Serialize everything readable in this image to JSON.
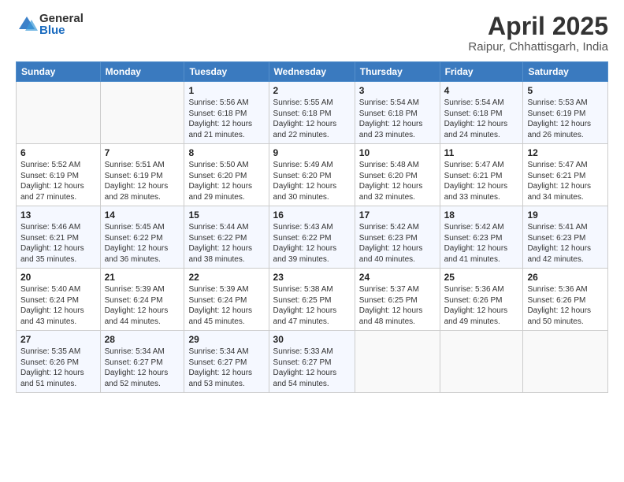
{
  "header": {
    "logo_general": "General",
    "logo_blue": "Blue",
    "title": "April 2025",
    "location": "Raipur, Chhattisgarh, India"
  },
  "days_of_week": [
    "Sunday",
    "Monday",
    "Tuesday",
    "Wednesday",
    "Thursday",
    "Friday",
    "Saturday"
  ],
  "weeks": [
    [
      {
        "day": "",
        "info": ""
      },
      {
        "day": "",
        "info": ""
      },
      {
        "day": "1",
        "info": "Sunrise: 5:56 AM\nSunset: 6:18 PM\nDaylight: 12 hours and 21 minutes."
      },
      {
        "day": "2",
        "info": "Sunrise: 5:55 AM\nSunset: 6:18 PM\nDaylight: 12 hours and 22 minutes."
      },
      {
        "day": "3",
        "info": "Sunrise: 5:54 AM\nSunset: 6:18 PM\nDaylight: 12 hours and 23 minutes."
      },
      {
        "day": "4",
        "info": "Sunrise: 5:54 AM\nSunset: 6:18 PM\nDaylight: 12 hours and 24 minutes."
      },
      {
        "day": "5",
        "info": "Sunrise: 5:53 AM\nSunset: 6:19 PM\nDaylight: 12 hours and 26 minutes."
      }
    ],
    [
      {
        "day": "6",
        "info": "Sunrise: 5:52 AM\nSunset: 6:19 PM\nDaylight: 12 hours and 27 minutes."
      },
      {
        "day": "7",
        "info": "Sunrise: 5:51 AM\nSunset: 6:19 PM\nDaylight: 12 hours and 28 minutes."
      },
      {
        "day": "8",
        "info": "Sunrise: 5:50 AM\nSunset: 6:20 PM\nDaylight: 12 hours and 29 minutes."
      },
      {
        "day": "9",
        "info": "Sunrise: 5:49 AM\nSunset: 6:20 PM\nDaylight: 12 hours and 30 minutes."
      },
      {
        "day": "10",
        "info": "Sunrise: 5:48 AM\nSunset: 6:20 PM\nDaylight: 12 hours and 32 minutes."
      },
      {
        "day": "11",
        "info": "Sunrise: 5:47 AM\nSunset: 6:21 PM\nDaylight: 12 hours and 33 minutes."
      },
      {
        "day": "12",
        "info": "Sunrise: 5:47 AM\nSunset: 6:21 PM\nDaylight: 12 hours and 34 minutes."
      }
    ],
    [
      {
        "day": "13",
        "info": "Sunrise: 5:46 AM\nSunset: 6:21 PM\nDaylight: 12 hours and 35 minutes."
      },
      {
        "day": "14",
        "info": "Sunrise: 5:45 AM\nSunset: 6:22 PM\nDaylight: 12 hours and 36 minutes."
      },
      {
        "day": "15",
        "info": "Sunrise: 5:44 AM\nSunset: 6:22 PM\nDaylight: 12 hours and 38 minutes."
      },
      {
        "day": "16",
        "info": "Sunrise: 5:43 AM\nSunset: 6:22 PM\nDaylight: 12 hours and 39 minutes."
      },
      {
        "day": "17",
        "info": "Sunrise: 5:42 AM\nSunset: 6:23 PM\nDaylight: 12 hours and 40 minutes."
      },
      {
        "day": "18",
        "info": "Sunrise: 5:42 AM\nSunset: 6:23 PM\nDaylight: 12 hours and 41 minutes."
      },
      {
        "day": "19",
        "info": "Sunrise: 5:41 AM\nSunset: 6:23 PM\nDaylight: 12 hours and 42 minutes."
      }
    ],
    [
      {
        "day": "20",
        "info": "Sunrise: 5:40 AM\nSunset: 6:24 PM\nDaylight: 12 hours and 43 minutes."
      },
      {
        "day": "21",
        "info": "Sunrise: 5:39 AM\nSunset: 6:24 PM\nDaylight: 12 hours and 44 minutes."
      },
      {
        "day": "22",
        "info": "Sunrise: 5:39 AM\nSunset: 6:24 PM\nDaylight: 12 hours and 45 minutes."
      },
      {
        "day": "23",
        "info": "Sunrise: 5:38 AM\nSunset: 6:25 PM\nDaylight: 12 hours and 47 minutes."
      },
      {
        "day": "24",
        "info": "Sunrise: 5:37 AM\nSunset: 6:25 PM\nDaylight: 12 hours and 48 minutes."
      },
      {
        "day": "25",
        "info": "Sunrise: 5:36 AM\nSunset: 6:26 PM\nDaylight: 12 hours and 49 minutes."
      },
      {
        "day": "26",
        "info": "Sunrise: 5:36 AM\nSunset: 6:26 PM\nDaylight: 12 hours and 50 minutes."
      }
    ],
    [
      {
        "day": "27",
        "info": "Sunrise: 5:35 AM\nSunset: 6:26 PM\nDaylight: 12 hours and 51 minutes."
      },
      {
        "day": "28",
        "info": "Sunrise: 5:34 AM\nSunset: 6:27 PM\nDaylight: 12 hours and 52 minutes."
      },
      {
        "day": "29",
        "info": "Sunrise: 5:34 AM\nSunset: 6:27 PM\nDaylight: 12 hours and 53 minutes."
      },
      {
        "day": "30",
        "info": "Sunrise: 5:33 AM\nSunset: 6:27 PM\nDaylight: 12 hours and 54 minutes."
      },
      {
        "day": "",
        "info": ""
      },
      {
        "day": "",
        "info": ""
      },
      {
        "day": "",
        "info": ""
      }
    ]
  ]
}
